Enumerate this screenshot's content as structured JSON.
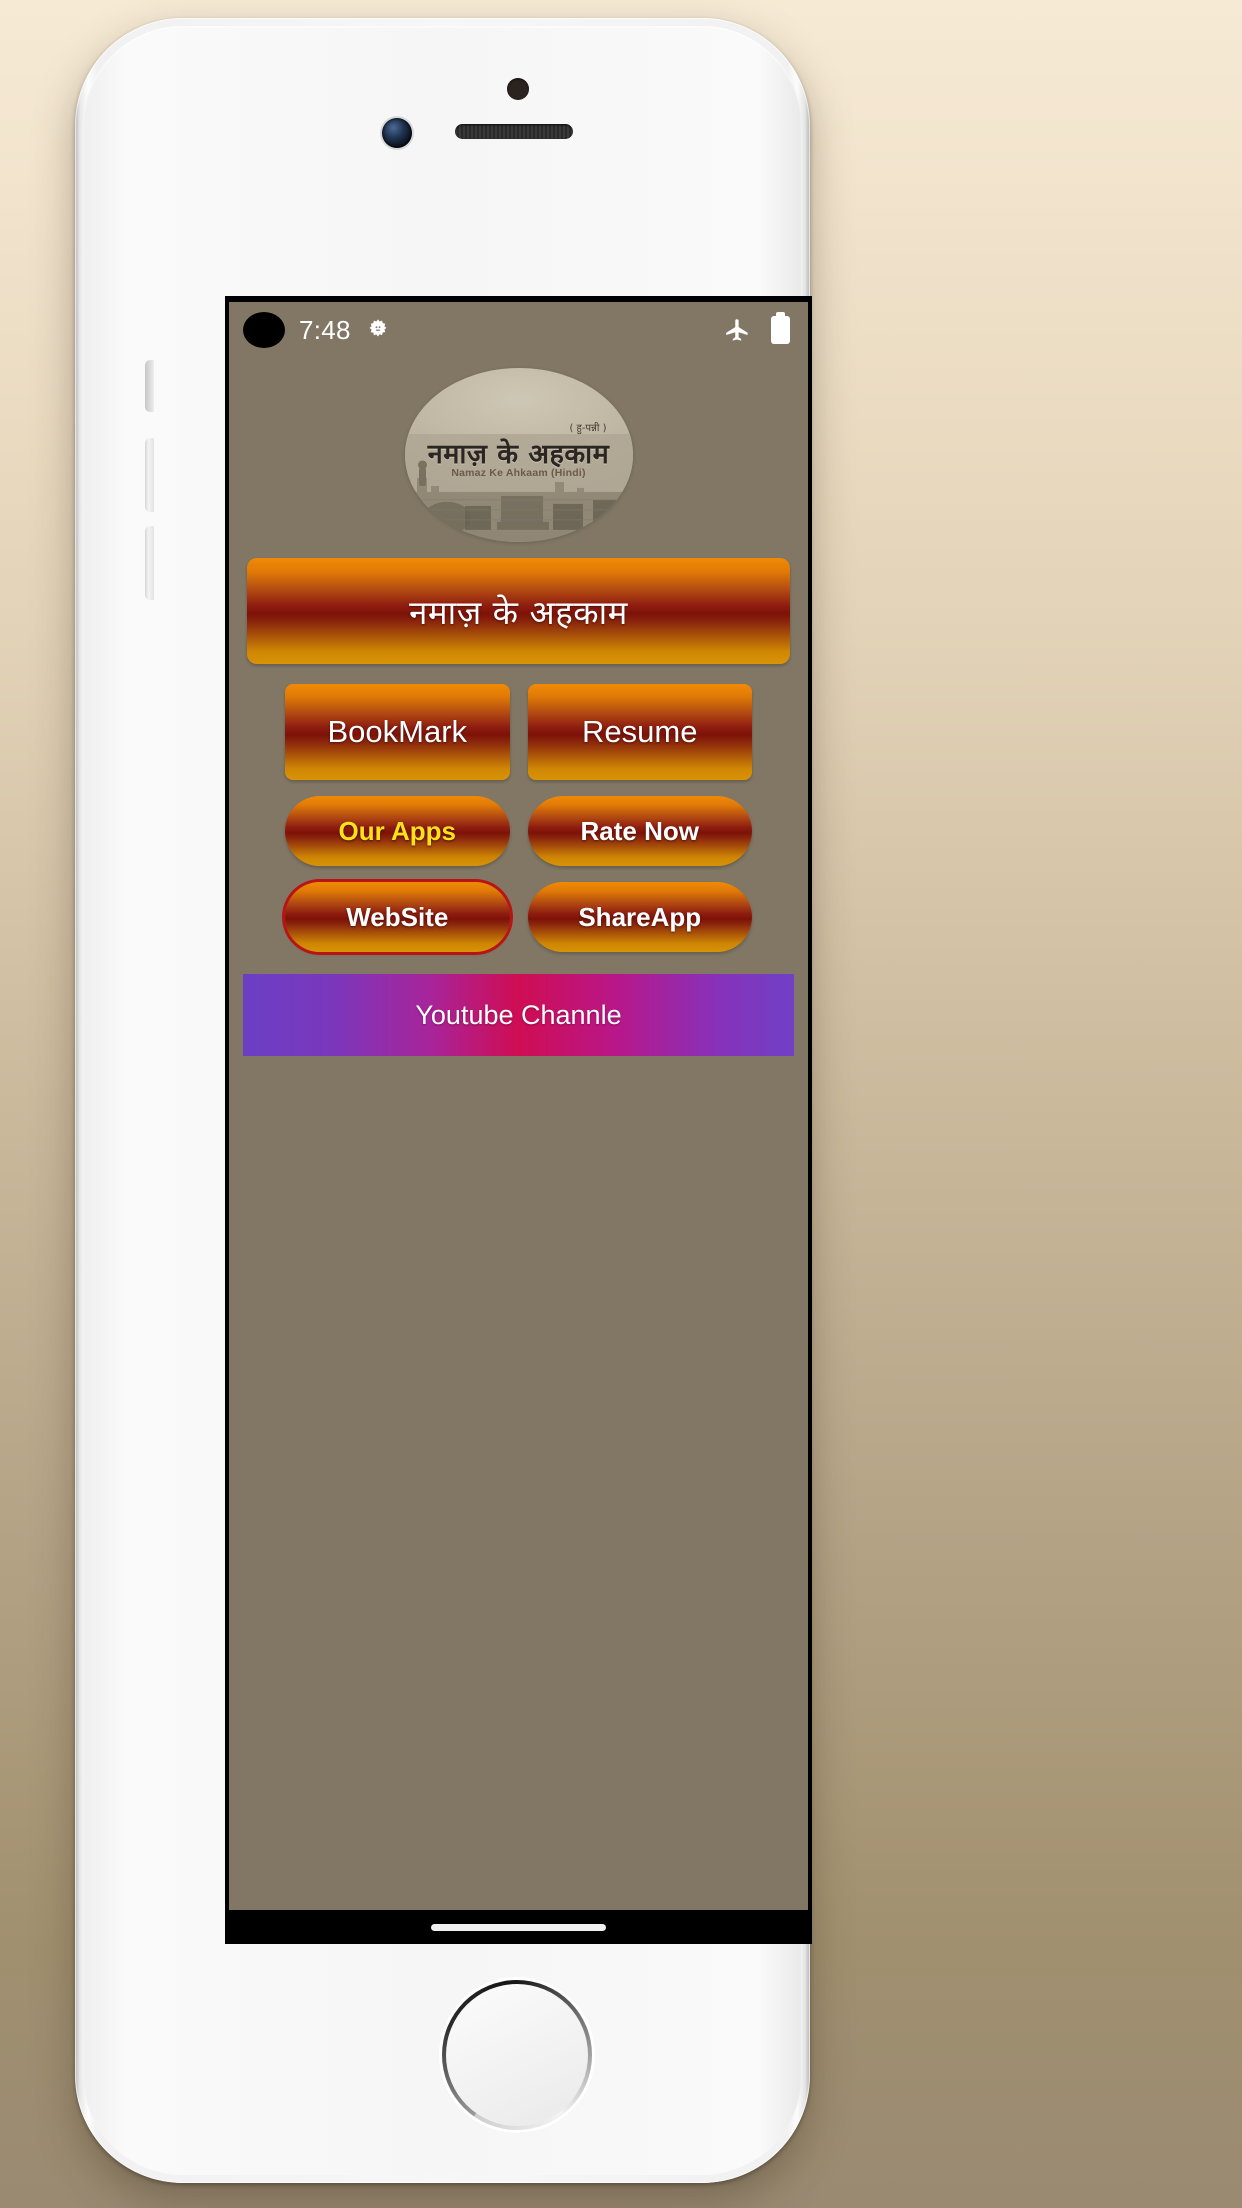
{
  "device": {
    "name": "white-smartphone",
    "hardware": {
      "proximity_sensor": "proximity-sensor",
      "front_camera": "front-camera",
      "earpiece_speaker": "earpiece-speaker",
      "home_button": "home-button",
      "power_button": "power-button",
      "volume_up": "volume-up-button",
      "volume_down": "volume-down-button",
      "silent_switch": "silent-switch"
    }
  },
  "status_bar": {
    "clock": "7:48",
    "notification_dot_icon": "notification-dot-icon",
    "gear_icon": "gear-icon",
    "airplane_mode_icon": "airplane-mode-icon",
    "battery_icon": "battery-icon",
    "battery_level_text": "",
    "text_color": "#ffffff"
  },
  "app": {
    "background_color": "#827765",
    "logo": {
      "name": "app-logo",
      "title_hindi": "नमाज़ के अहकाम",
      "badge_hindi": "( हु-पन्नी )",
      "subtitle": "Namaz Ke Ahkaam (Hindi)",
      "style": "sepia oval book cover with Mecca skyline"
    },
    "main_title_button": {
      "label": "नमाज़ के अहकाम",
      "text_color": "#ffffff",
      "gradient_top": "#f08a05",
      "gradient_mid": "#7d1208",
      "gradient_bottom": "#d89306"
    },
    "buttons_row_1": [
      {
        "label": "BookMark",
        "text_color": "#ffffff"
      },
      {
        "label": "Resume",
        "text_color": "#ffffff"
      }
    ],
    "buttons_row_2": [
      {
        "label": "Our Apps",
        "text_color": "#ffe11a"
      },
      {
        "label": "Rate Now",
        "text_color": "#ffffff"
      }
    ],
    "buttons_row_3": [
      {
        "label": "WebSite",
        "text_color": "#ffffff",
        "outline_color": "#b81414"
      },
      {
        "label": "ShareApp",
        "text_color": "#ffffff"
      }
    ],
    "youtube_banner": {
      "label": "Youtube Channle",
      "text_color": "#ffffff",
      "gradient_left": "#6b3fc4",
      "gradient_center": "#cf0d53",
      "gradient_right": "#7040c6"
    }
  },
  "navigation_bar": {
    "gesture_pill": "gesture-pill",
    "background_color": "#000000"
  }
}
